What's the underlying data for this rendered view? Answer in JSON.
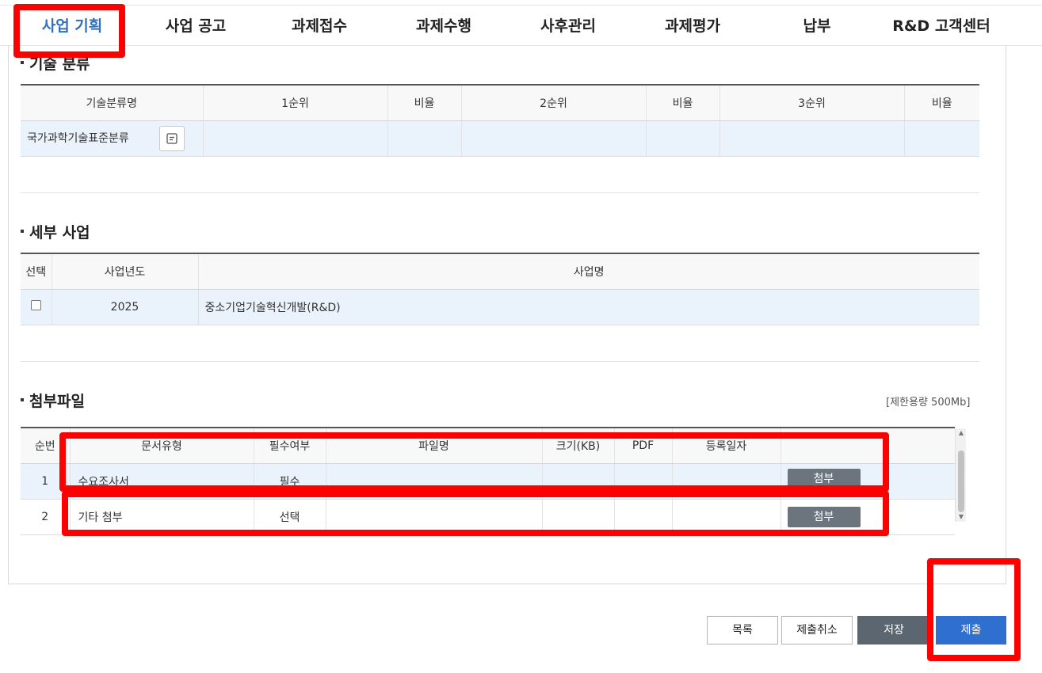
{
  "nav": {
    "items": [
      {
        "label": "사업 기획",
        "active": true
      },
      {
        "label": "사업 공고"
      },
      {
        "label": "과제접수"
      },
      {
        "label": "과제수행"
      },
      {
        "label": "사후관리"
      },
      {
        "label": "과제평가"
      },
      {
        "label": "납부"
      },
      {
        "label": "R&D 고객센터"
      }
    ]
  },
  "tech": {
    "title": "기술 분류",
    "headers": [
      "기술분류명",
      "1순위",
      "비율",
      "2순위",
      "비율",
      "3순위",
      "비율"
    ],
    "row": {
      "name": "국가과학기술표준분류",
      "icon": "list-icon"
    }
  },
  "detail": {
    "title": "세부 사업",
    "headers": [
      "선택",
      "사업년도",
      "사업명"
    ],
    "row": {
      "year": "2025",
      "name": "중소기업기술혁신개발(R&D)"
    }
  },
  "attach": {
    "title": "첨부파일",
    "limit": "[제한용량 500Mb]",
    "headers": [
      "순번",
      "문서유형",
      "필수여부",
      "파일명",
      "크기(KB)",
      "PDF",
      "등록일자",
      ""
    ],
    "rows": [
      {
        "no": "1",
        "type": "수요조사서",
        "required": "필수",
        "button": "첨부"
      },
      {
        "no": "2",
        "type": "기타 첨부",
        "required": "선택",
        "button": "첨부"
      }
    ]
  },
  "actions": {
    "list": "목록",
    "cancel": "제출취소",
    "save": "저장",
    "submit": "제출"
  },
  "colors": {
    "accent": "#2e6fcf",
    "highlight": "#ff0000",
    "row_bg": "#eaf2fb"
  }
}
